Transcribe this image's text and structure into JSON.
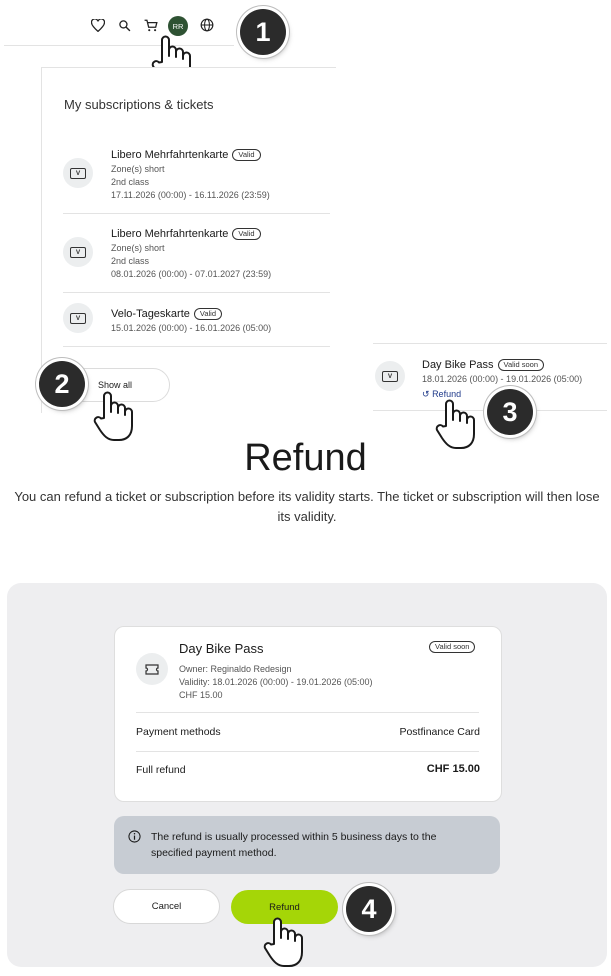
{
  "header": {
    "avatar_initials": "RR",
    "icons": [
      "heart-icon",
      "search-icon",
      "cart-icon",
      "globe-icon"
    ]
  },
  "steps": [
    "1",
    "2",
    "3",
    "4"
  ],
  "subscriptions": {
    "title": "My subscriptions & tickets",
    "ticket_icon_letter": "V",
    "items": [
      {
        "name": "Libero Mehrfahrtenkarte",
        "status": "Valid",
        "lines": [
          "Zone(s) short",
          "2nd class",
          "17.11.2026 (00:00) - 16.11.2026 (23:59)"
        ]
      },
      {
        "name": "Libero Mehrfahrtenkarte",
        "status": "Valid",
        "lines": [
          "Zone(s) short",
          "2nd class",
          "08.01.2026 (00:00) - 07.01.2027 (23:59)"
        ]
      },
      {
        "name": "Velo-Tageskarte",
        "status": "Valid",
        "lines": [
          "15.01.2026 (00:00) - 16.01.2026 (05:00)"
        ]
      }
    ],
    "show_all_label": "Show all"
  },
  "mini_card": {
    "name": "Day Bike Pass",
    "status": "Valid soon",
    "validity": "18.01.2026 (00:00) - 19.01.2026 (05:00)",
    "refund_label": "Refund"
  },
  "section": {
    "heading": "Refund",
    "intro": "You can refund a ticket or subscription before its validity starts. The ticket or subscription will then lose its validity."
  },
  "dialog": {
    "title": "Day Bike Pass",
    "status": "Valid soon",
    "owner": "Owner: Reginaldo Redesign",
    "validity": "Validity: 18.01.2026 (00:00) - 19.01.2026 (05:00)",
    "price": "CHF 15.00",
    "payment_label": "Payment methods",
    "payment_value": "Postfinance Card",
    "refund_label": "Full refund",
    "refund_value": "CHF 15.00",
    "info_text": "The refund is usually processed within 5 business days to the specified payment method.",
    "cancel_label": "Cancel",
    "confirm_label": "Refund"
  },
  "colors": {
    "accent_green": "#a5d607",
    "avatar_green": "#2e5233",
    "info_bg": "#c7ccd3",
    "link_blue": "#1f3a8a"
  }
}
